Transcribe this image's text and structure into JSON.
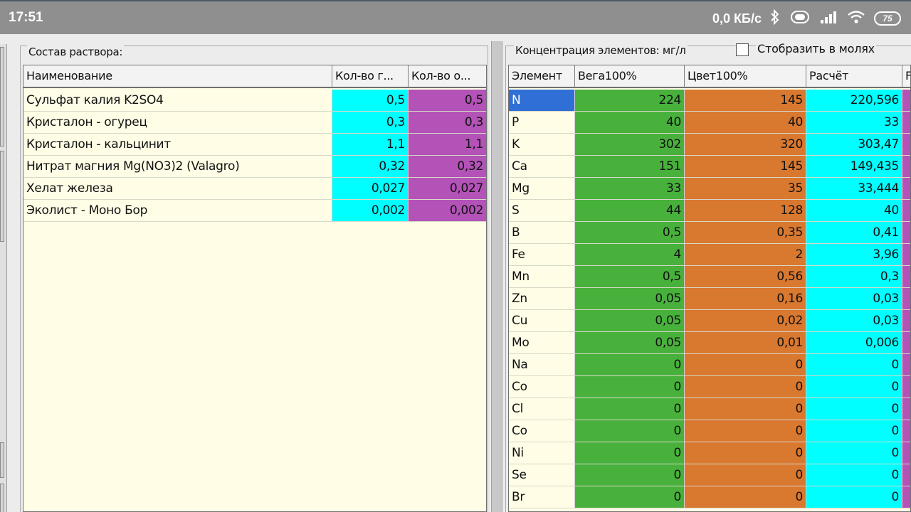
{
  "status_bar": {
    "time": "17:51",
    "net_speed": "0,0 КБ/с",
    "battery": "75",
    "icons": [
      "bluetooth-icon",
      "vibrate-icon",
      "signal-icon",
      "wifi-icon",
      "battery-icon"
    ]
  },
  "left_panel": {
    "title": "Состав раствора:",
    "columns": [
      "Наименование",
      "Кол-во г...",
      "Кол-во о..."
    ],
    "rows": [
      {
        "name": "Сульфат калия K2SO4",
        "g": "0,5",
        "o": "0,5"
      },
      {
        "name": "Кристалон - огурец",
        "g": "0,3",
        "o": "0,3"
      },
      {
        "name": "Кристалон - кальцинит",
        "g": "1,1",
        "o": "1,1"
      },
      {
        "name": "Нитрат магния Mg(NO3)2 (Valagro)",
        "g": "0,32",
        "o": "0,32"
      },
      {
        "name": "Хелат железа",
        "g": "0,027",
        "o": "0,027"
      },
      {
        "name": "Эколист - Моно Бор",
        "g": "0,002",
        "o": "0,002"
      }
    ]
  },
  "right_panel": {
    "title": "Концентрация элементов: мг/л",
    "checkbox_label": "Стобразить в молях",
    "columns": [
      "Элемент",
      "Вега100%",
      "Цвет100%",
      "Расчёт",
      "F"
    ],
    "rows": [
      {
        "el": "N",
        "vega": "224",
        "cvet": "145",
        "calc": "220,596"
      },
      {
        "el": "P",
        "vega": "40",
        "cvet": "40",
        "calc": "33"
      },
      {
        "el": "K",
        "vega": "302",
        "cvet": "320",
        "calc": "303,47"
      },
      {
        "el": "Ca",
        "vega": "151",
        "cvet": "145",
        "calc": "149,435"
      },
      {
        "el": "Mg",
        "vega": "33",
        "cvet": "35",
        "calc": "33,444"
      },
      {
        "el": "S",
        "vega": "44",
        "cvet": "128",
        "calc": "40"
      },
      {
        "el": "B",
        "vega": "0,5",
        "cvet": "0,35",
        "calc": "0,41"
      },
      {
        "el": "Fe",
        "vega": "4",
        "cvet": "2",
        "calc": "3,96"
      },
      {
        "el": "Mn",
        "vega": "0,5",
        "cvet": "0,56",
        "calc": "0,3"
      },
      {
        "el": "Zn",
        "vega": "0,05",
        "cvet": "0,16",
        "calc": "0,03"
      },
      {
        "el": "Cu",
        "vega": "0,05",
        "cvet": "0,02",
        "calc": "0,03"
      },
      {
        "el": "Mo",
        "vega": "0,05",
        "cvet": "0,01",
        "calc": "0,006"
      },
      {
        "el": "Na",
        "vega": "0",
        "cvet": "0",
        "calc": "0"
      },
      {
        "el": "Co",
        "vega": "0",
        "cvet": "0",
        "calc": "0"
      },
      {
        "el": "Cl",
        "vega": "0",
        "cvet": "0",
        "calc": "0"
      },
      {
        "el": "Co",
        "vega": "0",
        "cvet": "0",
        "calc": "0"
      },
      {
        "el": "Ni",
        "vega": "0",
        "cvet": "0",
        "calc": "0"
      },
      {
        "el": "Se",
        "vega": "0",
        "cvet": "0",
        "calc": "0"
      },
      {
        "el": "Br",
        "vega": "0",
        "cvet": "0",
        "calc": "0"
      }
    ]
  },
  "colors": {
    "grid_bg": "#fffde6",
    "cyan": "#00ffff",
    "magenta": "#b352b7",
    "green": "#48b13c",
    "orange": "#d9782f",
    "selection": "#2f6fd6"
  }
}
